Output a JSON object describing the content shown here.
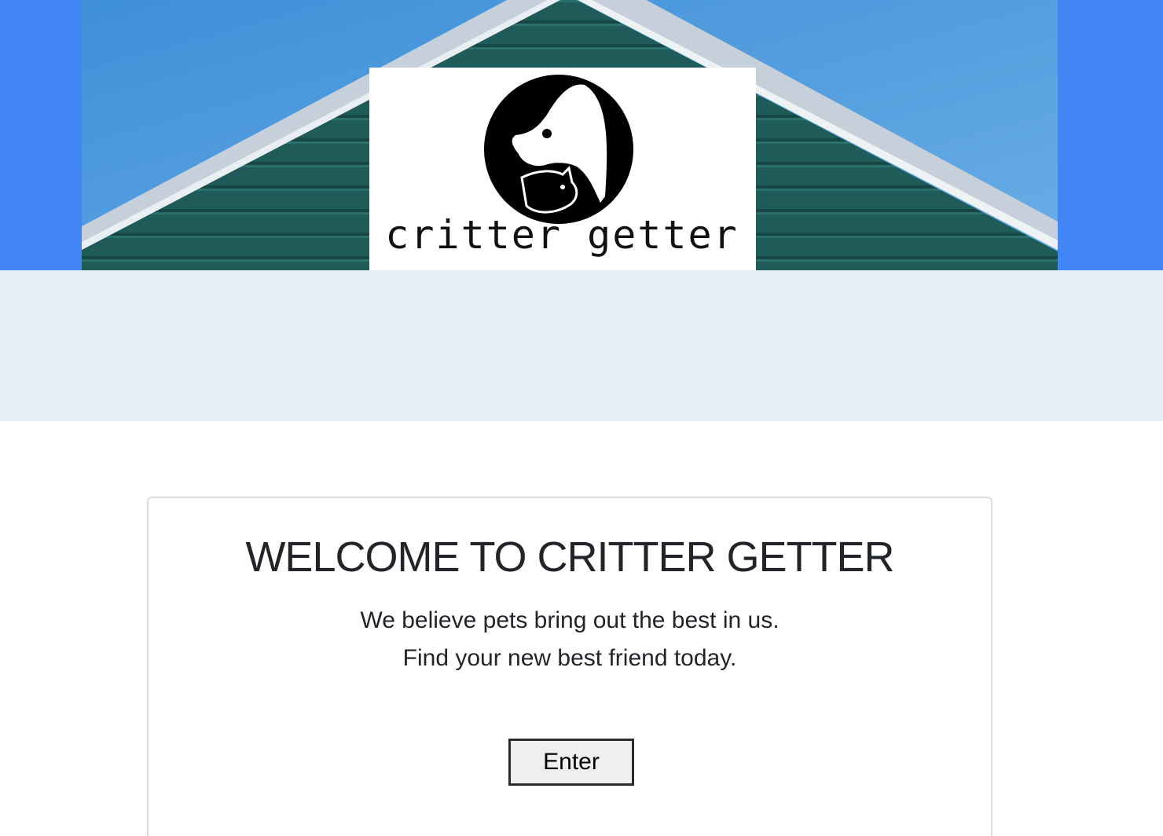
{
  "header": {
    "logo_text": "critter getter",
    "colors": {
      "band": "#4285f4",
      "sky": "#5aa0e0",
      "siding": "#1f5a57",
      "roof_trim": "#c9d2dc",
      "strip": "#e8eff7"
    }
  },
  "welcome": {
    "title": "WELCOME TO CRITTER GETTER",
    "line1": "We believe pets bring out the best in us.",
    "line2": "Find your new best friend today.",
    "enter_label": "Enter"
  }
}
